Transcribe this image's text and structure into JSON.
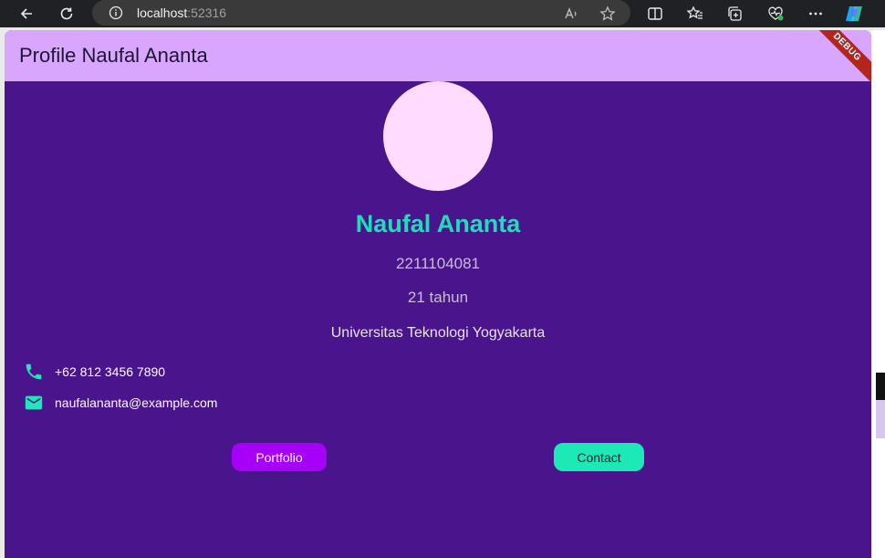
{
  "browser": {
    "url_host": "localhost",
    "url_port": ":52316"
  },
  "app": {
    "title": "Profile Naufal Ananta",
    "debug_banner": "DEBUG",
    "background_color": "#4a148c",
    "appbar_color": "#d9a6ff"
  },
  "profile": {
    "name": "Naufal Ananta",
    "nim": "2211104081",
    "age": "21 tahun",
    "university": "Universitas Teknologi Yogyakarta",
    "phone": "+62 812 3456 7890",
    "email": "naufalananta@example.com"
  },
  "actions": {
    "portfolio_label": "Portfolio",
    "contact_label": "Contact"
  },
  "icons": {
    "phone": "phone-icon",
    "email": "email-icon"
  }
}
